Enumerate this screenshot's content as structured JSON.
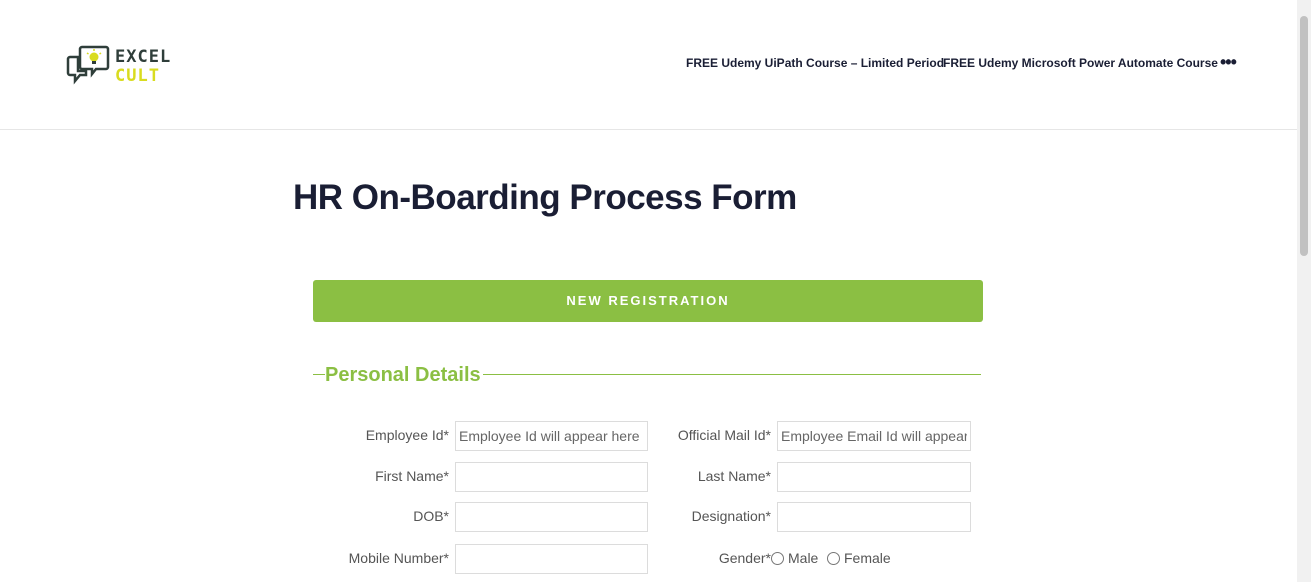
{
  "brand": {
    "line1": "EXCEL",
    "line2": "CULT",
    "colors": {
      "dark": "#2f3e3a",
      "accent": "#d9dc1f"
    },
    "icon": "chat-bubbles-lightbulb-icon"
  },
  "nav": {
    "links": [
      "FREE Udemy UiPath Course – Limited Period",
      "FREE Udemy Microsoft Power Automate Course"
    ],
    "more": "•••"
  },
  "page": {
    "title": "HR On-Boarding Process Form"
  },
  "form": {
    "new_registration_label": "NEW REGISTRATION",
    "accent_color": "#8bbf43",
    "section_title": "Personal Details",
    "fields": {
      "employee_id": {
        "label": "Employee Id*",
        "placeholder": "Employee Id will appear here"
      },
      "official_mail": {
        "label": "Official Mail Id*",
        "placeholder": "Employee Email Id will appear here"
      },
      "first_name": {
        "label": "First Name*",
        "value": ""
      },
      "last_name": {
        "label": "Last Name*",
        "value": ""
      },
      "dob": {
        "label": "DOB*",
        "value": ""
      },
      "designation": {
        "label": "Designation*",
        "value": ""
      },
      "mobile": {
        "label": "Mobile Number*",
        "value": ""
      },
      "gender": {
        "label": "Gender*",
        "options": [
          "Male",
          "Female"
        ]
      }
    }
  }
}
